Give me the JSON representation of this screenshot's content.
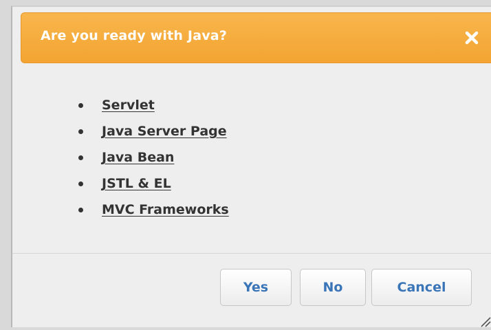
{
  "dialog": {
    "title": "Are you ready with Java?",
    "close_icon": "close-icon",
    "accent_color": "#f5a93a"
  },
  "topics": [
    {
      "label": "Servlet"
    },
    {
      "label": "Java Server Page"
    },
    {
      "label": "Java Bean"
    },
    {
      "label": "JSTL & EL"
    },
    {
      "label": "MVC Frameworks"
    }
  ],
  "buttons": {
    "yes_label": "Yes",
    "no_label": "No",
    "cancel_label": "Cancel"
  },
  "colors": {
    "button_text": "#3a75b8",
    "link_text": "#333333",
    "background": "#eeeeee"
  }
}
